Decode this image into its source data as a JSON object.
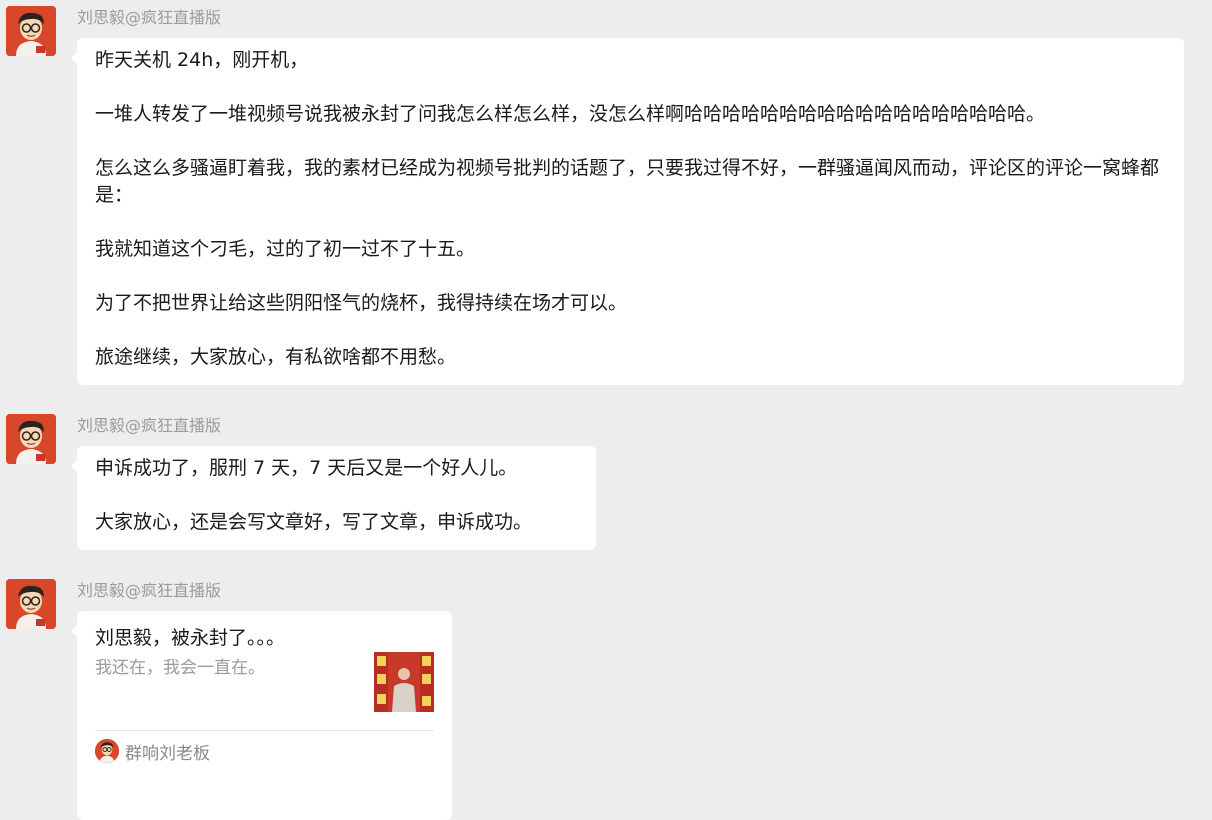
{
  "messages": [
    {
      "sender": "刘思毅@疯狂直播版",
      "paragraphs": [
        "昨天关机 24h，刚开机，",
        "一堆人转发了一堆视频号说我被永封了问我怎么样怎么样，没怎么样啊哈哈哈哈哈哈哈哈哈哈哈哈哈哈哈哈哈哈。",
        "怎么这么多骚逼盯着我，我的素材已经成为视频号批判的话题了，只要我过得不好，一群骚逼闻风而动，评论区的评论一窝蜂都是：",
        "我就知道这个刁毛，过的了初一过不了十五。",
        "为了不把世界让给这些阴阳怪气的烧杯，我得持续在场才可以。",
        "旅途继续，大家放心，有私欲啥都不用愁。"
      ]
    },
    {
      "sender": "刘思毅@疯狂直播版",
      "paragraphs": [
        "申诉成功了，服刑 7 天，7 天后又是一个好人儿。",
        "大家放心，还是会写文章好，写了文章，申诉成功。"
      ]
    },
    {
      "sender": "刘思毅@疯狂直播版",
      "card": {
        "title": "刘思毅，被永封了。。。",
        "description": "我还在，我会一直在。",
        "source": "群响刘老板"
      }
    }
  ],
  "colors": {
    "background": "#ededed",
    "bubble": "#ffffff",
    "avatar_bg": "#d9472b",
    "sender_text": "#9b9b9b"
  }
}
